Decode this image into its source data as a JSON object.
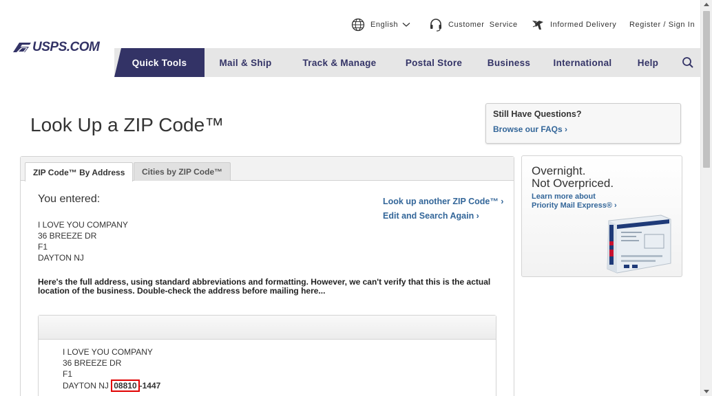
{
  "header": {
    "logo": "USPS.COM",
    "utility": {
      "language": "English",
      "customer_service": "Customer  Service",
      "informed_delivery": "Informed Delivery",
      "register": "Register / Sign In"
    }
  },
  "nav": {
    "items": [
      "Quick Tools",
      "Mail & Ship",
      "Track & Manage",
      "Postal Store",
      "Business",
      "International",
      "Help"
    ]
  },
  "page": {
    "title": "Look Up a ZIP Code™"
  },
  "questions": {
    "title": "Still Have Questions?",
    "link": "Browse our FAQs ›"
  },
  "tabs": [
    "ZIP Code™ By Address",
    "Cities by ZIP Code™"
  ],
  "entered": {
    "heading": "You entered:",
    "lines": [
      "I LOVE YOU COMPANY",
      "36 BREEZE DR",
      "F1",
      "DAYTON NJ"
    ]
  },
  "links": {
    "another": "Look up another ZIP Code™ ›",
    "edit": "Edit and Search Again ›"
  },
  "notice": "Here's the full address, using standard abbreviations and formatting. However, we can't verify that this is the actual location of the business. Double-check the address before mailing here...",
  "result": {
    "lines": [
      "I LOVE YOU COMPANY",
      "36 BREEZE DR",
      "F1"
    ],
    "city_state": "DAYTON NJ",
    "zip5": "08810",
    "zip4": "-1447"
  },
  "ad": {
    "line1": "Overnight.",
    "line2": "Not Overpriced.",
    "link_line1": "Learn more about",
    "link_line2": "Priority Mail Express® ›"
  },
  "colors": {
    "brand_navy": "#333366",
    "link_blue": "#336699",
    "zip_highlight": "#e00000"
  }
}
